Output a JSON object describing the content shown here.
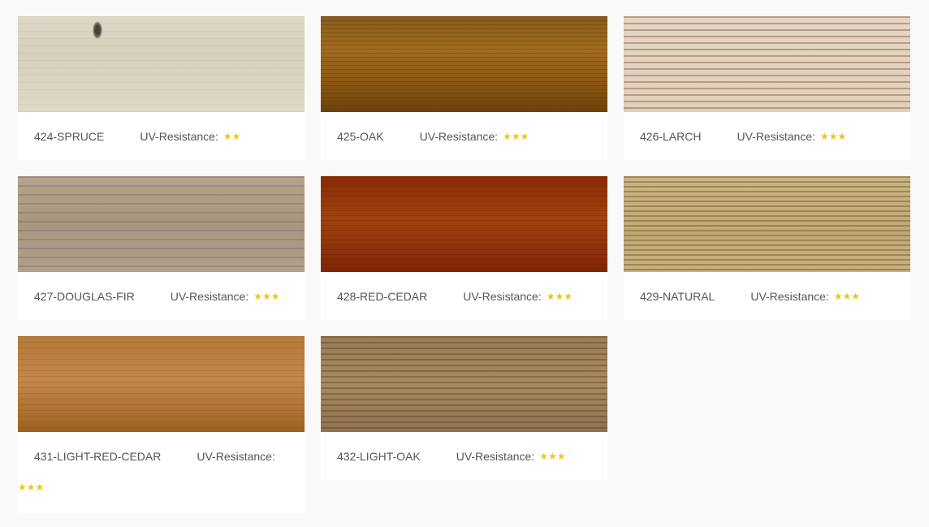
{
  "uv_label": "UV-Resistance:",
  "products": [
    {
      "name": "424-SPRUCE",
      "uv_stars": "★★",
      "rating": 2,
      "swatch_color": "#d9d3c1"
    },
    {
      "name": "425-OAK",
      "uv_stars": "★★★",
      "rating": 3,
      "swatch_color": "#8f5c18"
    },
    {
      "name": "426-LARCH",
      "uv_stars": "★★★",
      "rating": 3,
      "swatch_color": "#e0cfba"
    },
    {
      "name": "427-DOUGLAS-FIR",
      "uv_stars": "★★★",
      "rating": 3,
      "swatch_color": "#ae9c85"
    },
    {
      "name": "428-RED-CEDAR",
      "uv_stars": "★★★",
      "rating": 3,
      "swatch_color": "#8f300a"
    },
    {
      "name": "429-NATURAL",
      "uv_stars": "★★★",
      "rating": 3,
      "swatch_color": "#c6ad7b"
    },
    {
      "name": "431-LIGHT-RED-CEDAR",
      "uv_stars": "★★★",
      "rating": 3,
      "swatch_color": "#b47a39"
    },
    {
      "name": "432-LIGHT-OAK",
      "uv_stars": "★★★",
      "rating": 3,
      "swatch_color": "#9f8159"
    }
  ],
  "colors": {
    "page_background": "#f9f9f9",
    "card_background": "#ffffff",
    "label_text": "#555555",
    "star": "#f2c318"
  }
}
